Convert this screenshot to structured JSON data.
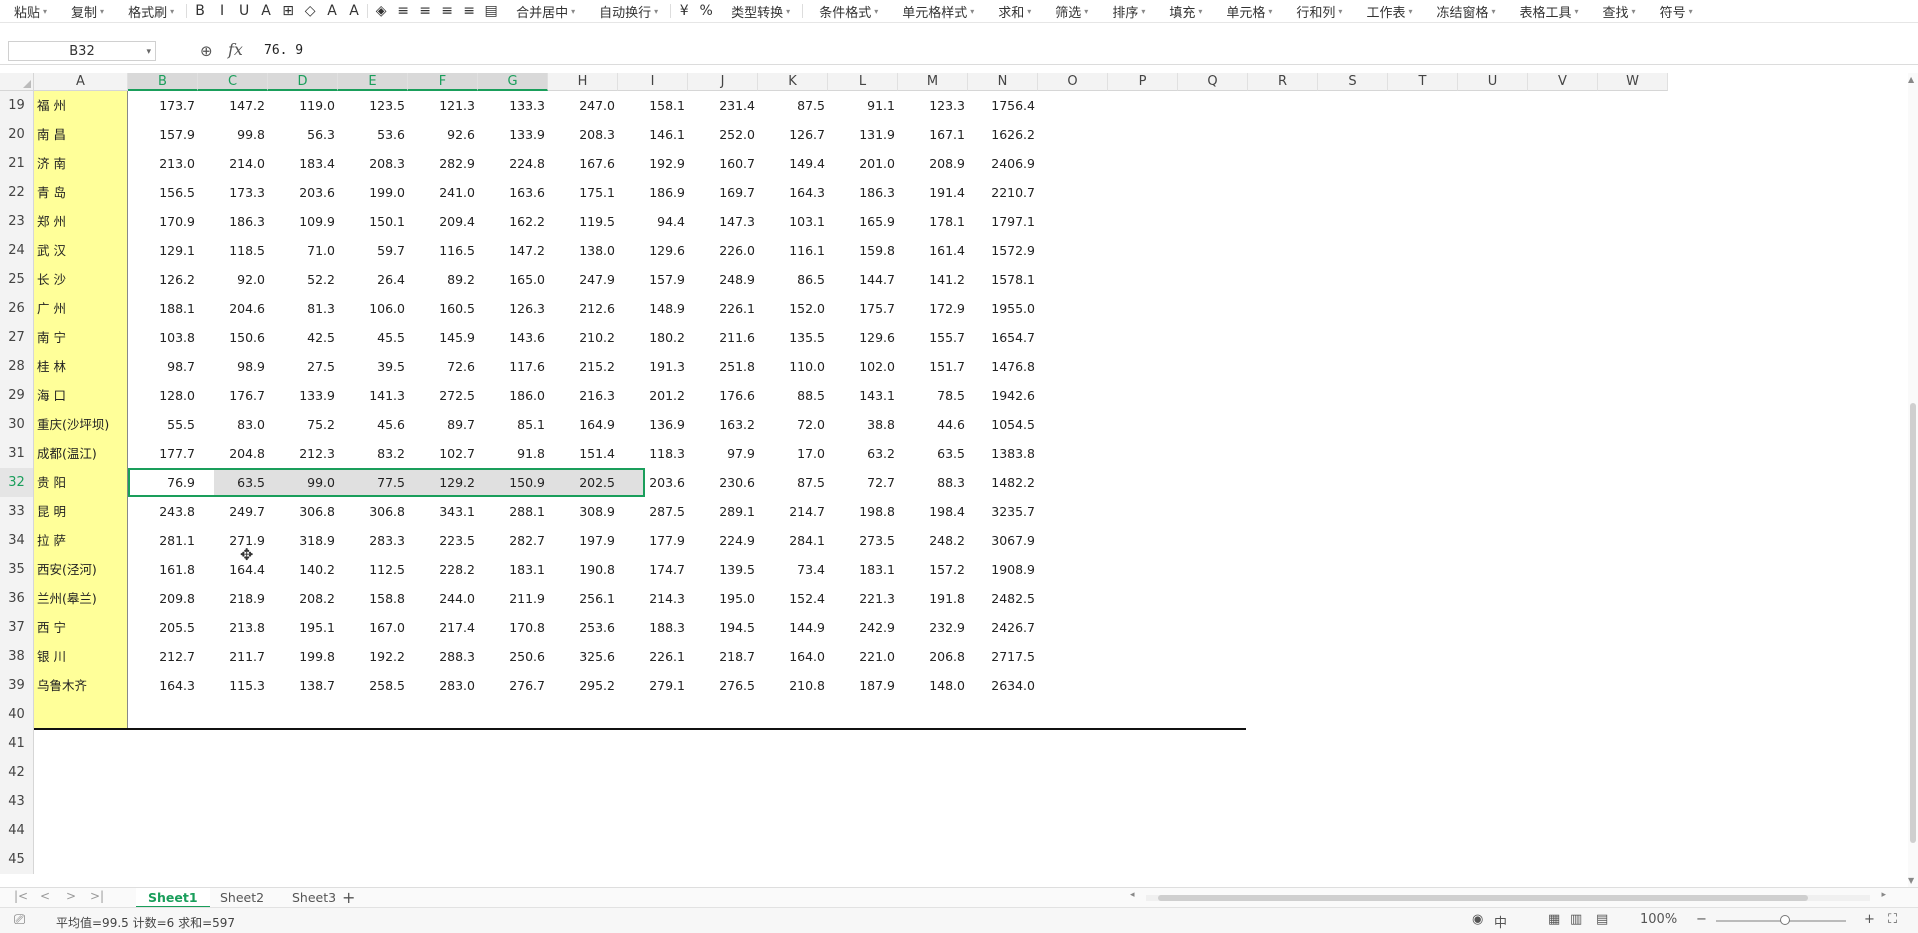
{
  "toolbar": {
    "items": [
      "粘贴",
      "复制",
      "格式刷",
      "合并居中",
      "自动换行",
      "类型转换",
      "条件格式",
      "单元格样式",
      "求和",
      "筛选",
      "排序",
      "填充",
      "单元格",
      "行和列",
      "工作表",
      "冻结窗格",
      "表格工具",
      "查找",
      "符号"
    ],
    "format_icons": [
      "B",
      "I",
      "U",
      "A",
      "⊞",
      "◇",
      "A",
      "A",
      "◈",
      "≡",
      "≡",
      "≡",
      "≡",
      "▤",
      "¥",
      "%"
    ]
  },
  "formula_bar": {
    "cell_ref": "B32",
    "fx": "fx",
    "value": "76. 9"
  },
  "columns": [
    "A",
    "B",
    "C",
    "D",
    "E",
    "F",
    "G",
    "H",
    "I",
    "J",
    "K",
    "L",
    "M",
    "N",
    "O",
    "P",
    "Q",
    "R",
    "S",
    "T",
    "U",
    "V",
    "W"
  ],
  "rows": [
    {
      "n": "19",
      "city": "福 州",
      "v": [
        "173.7",
        "147.2",
        "119.0",
        "123.5",
        "121.3",
        "133.3",
        "247.0",
        "158.1",
        "231.4",
        "87.5",
        "91.1",
        "123.3",
        "1756.4"
      ]
    },
    {
      "n": "20",
      "city": "南 昌",
      "v": [
        "157.9",
        "99.8",
        "56.3",
        "53.6",
        "92.6",
        "133.9",
        "208.3",
        "146.1",
        "252.0",
        "126.7",
        "131.9",
        "167.1",
        "1626.2"
      ]
    },
    {
      "n": "21",
      "city": "济 南",
      "v": [
        "213.0",
        "214.0",
        "183.4",
        "208.3",
        "282.9",
        "224.8",
        "167.6",
        "192.9",
        "160.7",
        "149.4",
        "201.0",
        "208.9",
        "2406.9"
      ]
    },
    {
      "n": "22",
      "city": "青 岛",
      "v": [
        "156.5",
        "173.3",
        "203.6",
        "199.0",
        "241.0",
        "163.6",
        "175.1",
        "186.9",
        "169.7",
        "164.3",
        "186.3",
        "191.4",
        "2210.7"
      ]
    },
    {
      "n": "23",
      "city": "郑 州",
      "v": [
        "170.9",
        "186.3",
        "109.9",
        "150.1",
        "209.4",
        "162.2",
        "119.5",
        "94.4",
        "147.3",
        "103.1",
        "165.9",
        "178.1",
        "1797.1"
      ]
    },
    {
      "n": "24",
      "city": "武 汉",
      "v": [
        "129.1",
        "118.5",
        "71.0",
        "59.7",
        "116.5",
        "147.2",
        "138.0",
        "129.6",
        "226.0",
        "116.1",
        "159.8",
        "161.4",
        "1572.9"
      ]
    },
    {
      "n": "25",
      "city": "长 沙",
      "v": [
        "126.2",
        "92.0",
        "52.2",
        "26.4",
        "89.2",
        "165.0",
        "247.9",
        "157.9",
        "248.9",
        "86.5",
        "144.7",
        "141.2",
        "1578.1"
      ]
    },
    {
      "n": "26",
      "city": "广 州",
      "v": [
        "188.1",
        "204.6",
        "81.3",
        "106.0",
        "160.5",
        "126.3",
        "212.6",
        "148.9",
        "226.1",
        "152.0",
        "175.7",
        "172.9",
        "1955.0"
      ]
    },
    {
      "n": "27",
      "city": "南 宁",
      "v": [
        "103.8",
        "150.6",
        "42.5",
        "45.5",
        "145.9",
        "143.6",
        "210.2",
        "180.2",
        "211.6",
        "135.5",
        "129.6",
        "155.7",
        "1654.7"
      ]
    },
    {
      "n": "28",
      "city": "桂 林",
      "v": [
        "98.7",
        "98.9",
        "27.5",
        "39.5",
        "72.6",
        "117.6",
        "215.2",
        "191.3",
        "251.8",
        "110.0",
        "102.0",
        "151.7",
        "1476.8"
      ]
    },
    {
      "n": "29",
      "city": "海 口",
      "v": [
        "128.0",
        "176.7",
        "133.9",
        "141.3",
        "272.5",
        "186.0",
        "216.3",
        "201.2",
        "176.6",
        "88.5",
        "143.1",
        "78.5",
        "1942.6"
      ]
    },
    {
      "n": "30",
      "city": "重庆(沙坪坝)",
      "v": [
        "55.5",
        "83.0",
        "75.2",
        "45.6",
        "89.7",
        "85.1",
        "164.9",
        "136.9",
        "163.2",
        "72.0",
        "38.8",
        "44.6",
        "1054.5"
      ]
    },
    {
      "n": "31",
      "city": "成都(温江)",
      "v": [
        "177.7",
        "204.8",
        "212.3",
        "83.2",
        "102.7",
        "91.8",
        "151.4",
        "118.3",
        "97.9",
        "17.0",
        "63.2",
        "63.5",
        "1383.8"
      ]
    },
    {
      "n": "32",
      "city": "贵 阳",
      "v": [
        "76.9",
        "63.5",
        "99.0",
        "77.5",
        "129.2",
        "150.9",
        "202.5",
        "203.6",
        "230.6",
        "87.5",
        "72.7",
        "88.3",
        "1482.2"
      ]
    },
    {
      "n": "33",
      "city": "昆 明",
      "v": [
        "243.8",
        "249.7",
        "306.8",
        "306.8",
        "343.1",
        "288.1",
        "308.9",
        "287.5",
        "289.1",
        "214.7",
        "198.8",
        "198.4",
        "3235.7"
      ]
    },
    {
      "n": "34",
      "city": "拉 萨",
      "v": [
        "281.1",
        "271.9",
        "318.9",
        "283.3",
        "223.5",
        "282.7",
        "197.9",
        "177.9",
        "224.9",
        "284.1",
        "273.5",
        "248.2",
        "3067.9"
      ]
    },
    {
      "n": "35",
      "city": "西安(泾河)",
      "v": [
        "161.8",
        "164.4",
        "140.2",
        "112.5",
        "228.2",
        "183.1",
        "190.8",
        "174.7",
        "139.5",
        "73.4",
        "183.1",
        "157.2",
        "1908.9"
      ]
    },
    {
      "n": "36",
      "city": "兰州(皋兰)",
      "v": [
        "209.8",
        "218.9",
        "208.2",
        "158.8",
        "244.0",
        "211.9",
        "256.1",
        "214.3",
        "195.0",
        "152.4",
        "221.3",
        "191.8",
        "2482.5"
      ]
    },
    {
      "n": "37",
      "city": "西 宁",
      "v": [
        "205.5",
        "213.8",
        "195.1",
        "167.0",
        "217.4",
        "170.8",
        "253.6",
        "188.3",
        "194.5",
        "144.9",
        "242.9",
        "232.9",
        "2426.7"
      ]
    },
    {
      "n": "38",
      "city": "银 川",
      "v": [
        "212.7",
        "211.7",
        "199.8",
        "192.2",
        "288.3",
        "250.6",
        "325.6",
        "226.1",
        "218.7",
        "164.0",
        "221.0",
        "206.8",
        "2717.5"
      ]
    },
    {
      "n": "39",
      "city": "乌鲁木齐",
      "v": [
        "164.3",
        "115.3",
        "138.7",
        "258.5",
        "283.0",
        "276.7",
        "295.2",
        "279.1",
        "276.5",
        "210.8",
        "187.9",
        "148.0",
        "2634.0"
      ]
    },
    {
      "n": "40",
      "city": "",
      "v": []
    },
    {
      "n": "41",
      "city": "",
      "v": []
    },
    {
      "n": "42",
      "city": "",
      "v": []
    },
    {
      "n": "43",
      "city": "",
      "v": []
    },
    {
      "n": "44",
      "city": "",
      "v": []
    },
    {
      "n": "45",
      "city": "",
      "v": []
    }
  ],
  "selected_row": "32",
  "selected_columns": [
    "B",
    "C",
    "D",
    "E",
    "F",
    "G"
  ],
  "sheets": [
    {
      "label": "Sheet1",
      "active": true
    },
    {
      "label": "Sheet2",
      "active": false
    },
    {
      "label": "Sheet3",
      "active": false
    }
  ],
  "sheet_add": "+",
  "status": {
    "summary": "平均值=99.5  计数=6  求和=597",
    "zoom": "100%",
    "icon_eye": "◉",
    "icon_cn": "中"
  },
  "colors": {
    "accent": "#1a9e5b",
    "column_a_fill": "#ffff99",
    "selection_fill": "#e0e0e0"
  }
}
